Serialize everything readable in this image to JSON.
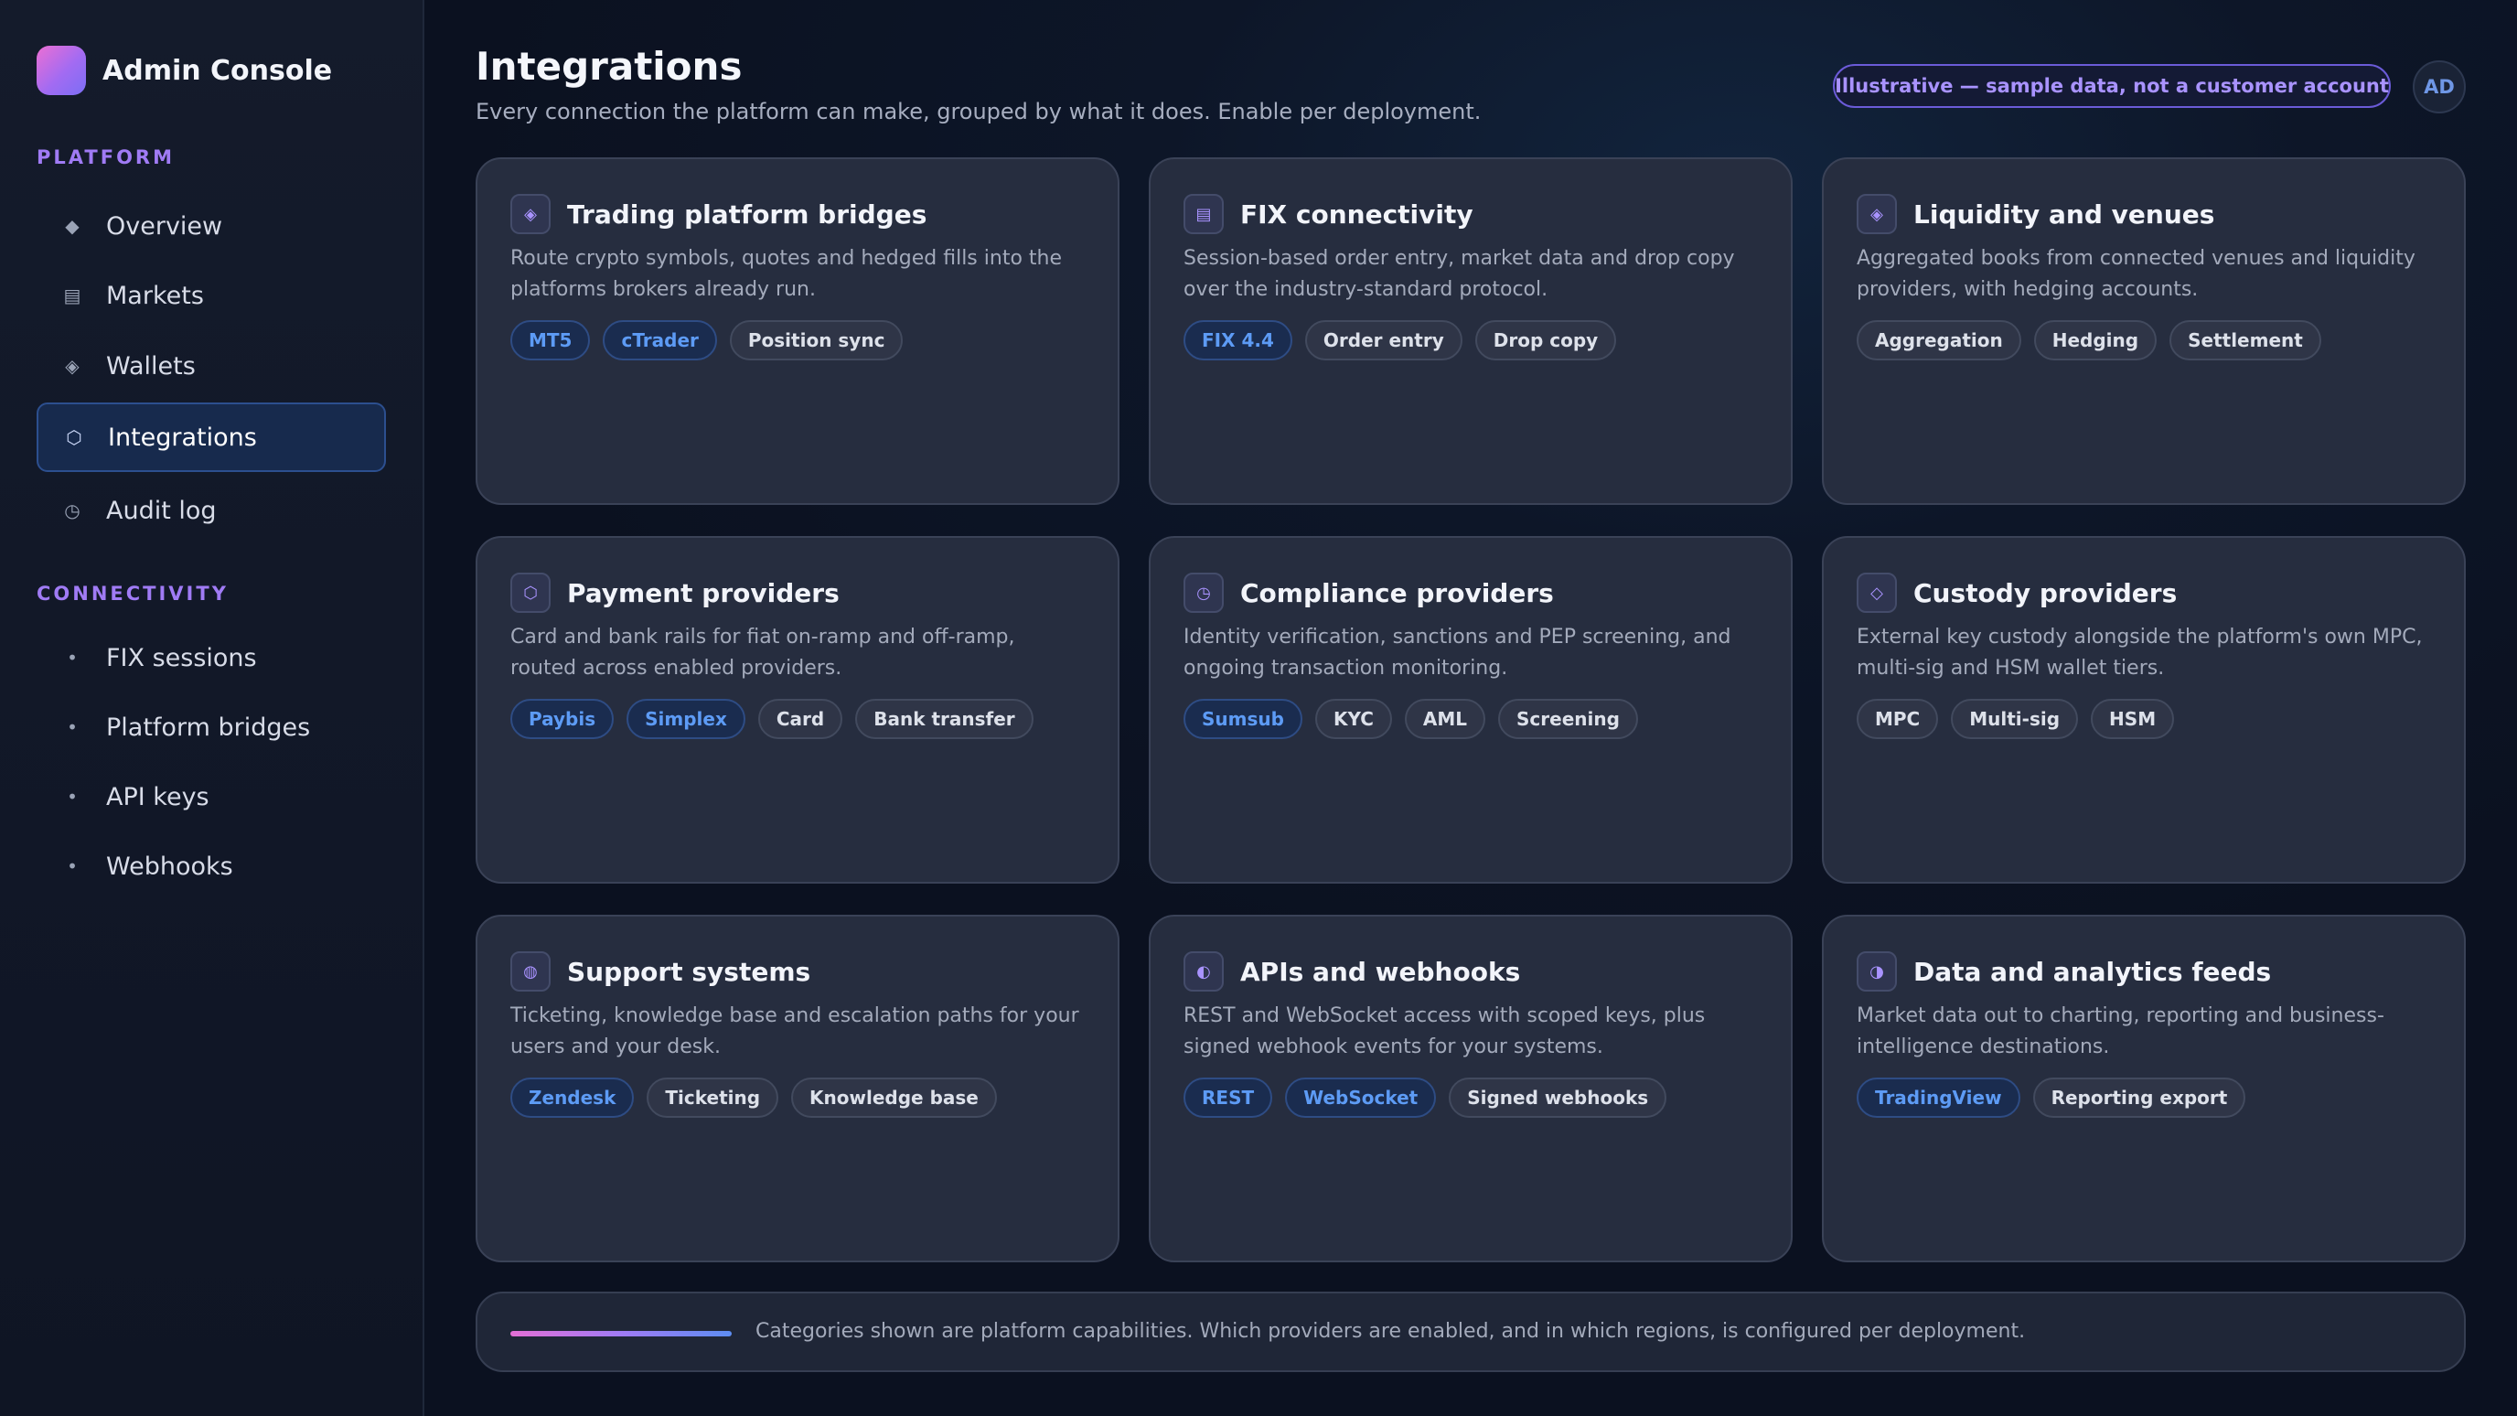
{
  "app": {
    "title": "Admin Console"
  },
  "sidebar": {
    "sections": [
      {
        "label": "PLATFORM",
        "items": [
          {
            "label": "Overview",
            "icon": "diamond-icon",
            "glyph": "◆"
          },
          {
            "label": "Markets",
            "icon": "list-icon",
            "glyph": "▤"
          },
          {
            "label": "Wallets",
            "icon": "wallet-diamond-icon",
            "glyph": "◈"
          },
          {
            "label": "Integrations",
            "icon": "hexagon-icon",
            "glyph": "⬡",
            "active": true
          },
          {
            "label": "Audit log",
            "icon": "clock-icon",
            "glyph": "◷"
          }
        ]
      },
      {
        "label": "CONNECTIVITY",
        "items": [
          {
            "label": "FIX sessions",
            "icon": "dot-icon",
            "glyph": "•"
          },
          {
            "label": "Platform bridges",
            "icon": "dot-icon",
            "glyph": "•"
          },
          {
            "label": "API keys",
            "icon": "dot-icon",
            "glyph": "•"
          },
          {
            "label": "Webhooks",
            "icon": "dot-icon",
            "glyph": "•"
          }
        ]
      }
    ]
  },
  "header": {
    "title": "Integrations",
    "subtitle": "Every connection the platform can make, grouped by what it does. Enable per deployment.",
    "notice": "Illustrative — sample data, not a customer account",
    "avatar_initials": "AD"
  },
  "cards": [
    {
      "title": "Trading platform bridges",
      "icon": "bridge-diamond-icon",
      "glyph": "◈",
      "description": "Route crypto symbols, quotes and hedged fills into the platforms brokers already run.",
      "tags": [
        {
          "label": "MT5",
          "brand": true
        },
        {
          "label": "cTrader",
          "brand": true
        },
        {
          "label": "Position sync",
          "brand": false
        }
      ]
    },
    {
      "title": "FIX connectivity",
      "icon": "list-icon",
      "glyph": "▤",
      "description": "Session-based order entry, market data and drop copy over the industry-standard protocol.",
      "tags": [
        {
          "label": "FIX 4.4",
          "brand": true
        },
        {
          "label": "Order entry",
          "brand": false
        },
        {
          "label": "Drop copy",
          "brand": false
        }
      ]
    },
    {
      "title": "Liquidity and venues",
      "icon": "venue-diamond-icon",
      "glyph": "◈",
      "description": "Aggregated books from connected venues and liquidity providers, with hedging accounts.",
      "tags": [
        {
          "label": "Aggregation",
          "brand": false
        },
        {
          "label": "Hedging",
          "brand": false
        },
        {
          "label": "Settlement",
          "brand": false
        }
      ]
    },
    {
      "title": "Payment providers",
      "icon": "hexagon-icon",
      "glyph": "⬡",
      "description": "Card and bank rails for fiat on-ramp and off-ramp, routed across enabled providers.",
      "tags": [
        {
          "label": "Paybis",
          "brand": true
        },
        {
          "label": "Simplex",
          "brand": true
        },
        {
          "label": "Card",
          "brand": false
        },
        {
          "label": "Bank transfer",
          "brand": false
        }
      ]
    },
    {
      "title": "Compliance providers",
      "icon": "clock-icon",
      "glyph": "◷",
      "description": "Identity verification, sanctions and PEP screening, and ongoing transaction monitoring.",
      "tags": [
        {
          "label": "Sumsub",
          "brand": true
        },
        {
          "label": "KYC",
          "brand": false
        },
        {
          "label": "AML",
          "brand": false
        },
        {
          "label": "Screening",
          "brand": false
        }
      ]
    },
    {
      "title": "Custody providers",
      "icon": "diamond-outline-icon",
      "glyph": "◇",
      "description": "External key custody alongside the platform's own MPC, multi-sig and HSM wallet tiers.",
      "tags": [
        {
          "label": "MPC",
          "brand": false
        },
        {
          "label": "Multi-sig",
          "brand": false
        },
        {
          "label": "HSM",
          "brand": false
        }
      ]
    },
    {
      "title": "Support systems",
      "icon": "support-circle-icon",
      "glyph": "◍",
      "description": "Ticketing, knowledge base and escalation paths for your users and your desk.",
      "tags": [
        {
          "label": "Zendesk",
          "brand": true
        },
        {
          "label": "Ticketing",
          "brand": false
        },
        {
          "label": "Knowledge base",
          "brand": false
        }
      ]
    },
    {
      "title": "APIs and webhooks",
      "icon": "half-circle-icon",
      "glyph": "◐",
      "description": "REST and WebSocket access with scoped keys, plus signed webhook events for your systems.",
      "tags": [
        {
          "label": "REST",
          "brand": true
        },
        {
          "label": "WebSocket",
          "brand": true
        },
        {
          "label": "Signed webhooks",
          "brand": false
        }
      ]
    },
    {
      "title": "Data and analytics feeds",
      "icon": "half-circle-right-icon",
      "glyph": "◑",
      "description": "Market data out to charting, reporting and business-intelligence destinations.",
      "tags": [
        {
          "label": "TradingView",
          "brand": true
        },
        {
          "label": "Reporting export",
          "brand": false
        }
      ]
    }
  ],
  "footer": {
    "text": "Categories shown are platform capabilities. Which providers are enabled, and in which regions, is configured per deployment."
  },
  "colors": {
    "accent_purple": "#a07bf5",
    "brand_tag_blue": "#5d9bf5",
    "active_nav_bg": "#172a4d",
    "card_bg": "#262d3f"
  }
}
